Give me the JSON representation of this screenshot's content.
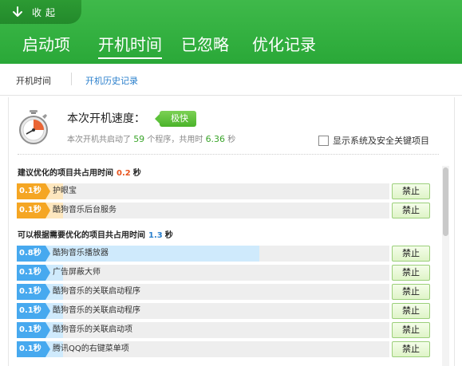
{
  "header": {
    "collapse_label": "收起",
    "tabs": [
      {
        "label": "启动项",
        "active": false
      },
      {
        "label": "开机时间",
        "active": true
      },
      {
        "label": "已忽略",
        "active": false
      },
      {
        "label": "优化记录",
        "active": false
      }
    ]
  },
  "subnav": {
    "items": [
      {
        "label": "开机时间",
        "active": true
      },
      {
        "label": "开机历史记录",
        "active": false
      }
    ]
  },
  "speed": {
    "title": "本次开机速度：",
    "badge": "极快",
    "desc_prefix": "本次开机共启动了",
    "program_count": "59",
    "desc_mid": "个程序，共用时",
    "total_time": "6.36",
    "desc_unit": "秒",
    "show_system_label": "显示系统及安全关键项目",
    "show_system_checked": false
  },
  "sections": [
    {
      "title": "建议优化的项目共占用时间",
      "time": "0.2",
      "unit": "秒",
      "color": "#e8541e",
      "items": [
        {
          "time": "0.1秒",
          "name": "护眼宝",
          "fraction": 0.125,
          "action": "禁止"
        },
        {
          "time": "0.1秒",
          "name": "酷狗音乐后台服务",
          "fraction": 0.125,
          "action": "禁止"
        }
      ]
    },
    {
      "title": "可以根据需要优化的项目共占用时间",
      "time": "1.3",
      "unit": "秒",
      "color": "#2a7fcc",
      "items": [
        {
          "time": "0.8秒",
          "name": "酷狗音乐播放器",
          "fraction": 0.65,
          "action": "禁止"
        },
        {
          "time": "0.1秒",
          "name": "广告屏蔽大师",
          "fraction": 0.125,
          "action": "禁止"
        },
        {
          "time": "0.1秒",
          "name": "酷狗音乐的关联启动程序",
          "fraction": 0.125,
          "action": "禁止"
        },
        {
          "time": "0.1秒",
          "name": "酷狗音乐的关联启动程序",
          "fraction": 0.125,
          "action": "禁止"
        },
        {
          "time": "0.1秒",
          "name": "酷狗音乐的关联启动项",
          "fraction": 0.125,
          "action": "禁止"
        },
        {
          "time": "0.1秒",
          "name": "腾讯QQ的右键菜单项",
          "fraction": 0.125,
          "action": "禁止"
        }
      ]
    }
  ],
  "colors": {
    "header_green": "#33b040",
    "orange": "#f5a623",
    "blue": "#47a9ef",
    "link_blue": "#2a7fcc"
  }
}
